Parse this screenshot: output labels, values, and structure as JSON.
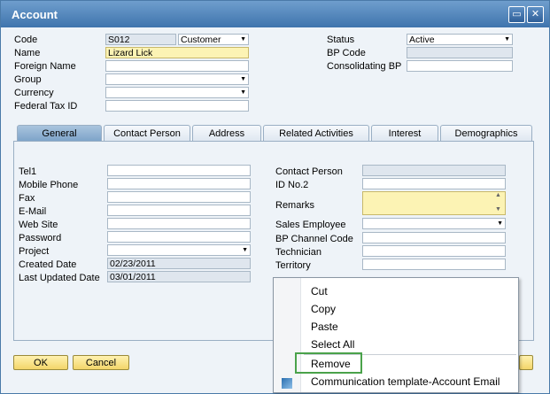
{
  "window": {
    "title": "Account"
  },
  "header": {
    "code": {
      "label": "Code",
      "value": "S012",
      "type": "Customer"
    },
    "name": {
      "label": "Name",
      "value": "Lizard Lick"
    },
    "foreign_name": {
      "label": "Foreign Name",
      "value": ""
    },
    "group": {
      "label": "Group",
      "value": ""
    },
    "currency": {
      "label": "Currency",
      "value": ""
    },
    "federal_tax_id": {
      "label": "Federal Tax ID",
      "value": ""
    },
    "status": {
      "label": "Status",
      "value": "Active"
    },
    "bp_code": {
      "label": "BP Code",
      "value": ""
    },
    "consolidating_bp": {
      "label": "Consolidating BP",
      "value": ""
    }
  },
  "tabs": [
    {
      "label": "General"
    },
    {
      "label": "Contact Person"
    },
    {
      "label": "Address"
    },
    {
      "label": "Related Activities"
    },
    {
      "label": "Interest"
    },
    {
      "label": "Demographics"
    }
  ],
  "general": {
    "tel1": {
      "label": "Tel1",
      "value": ""
    },
    "mobile_phone": {
      "label": "Mobile Phone",
      "value": ""
    },
    "fax": {
      "label": "Fax",
      "value": ""
    },
    "email": {
      "label": "E-Mail",
      "value": ""
    },
    "web_site": {
      "label": "Web Site",
      "value": ""
    },
    "password": {
      "label": "Password",
      "value": ""
    },
    "project": {
      "label": "Project",
      "value": ""
    },
    "created_date": {
      "label": "Created Date",
      "value": "02/23/2011"
    },
    "last_updated_date": {
      "label": "Last Updated Date",
      "value": "03/01/2011"
    },
    "contact_person": {
      "label": "Contact Person",
      "value": ""
    },
    "id_no2": {
      "label": "ID No.2",
      "value": ""
    },
    "remarks": {
      "label": "Remarks",
      "value": ""
    },
    "sales_employee": {
      "label": "Sales Employee",
      "value": ""
    },
    "bp_channel_code": {
      "label": "BP Channel Code",
      "value": ""
    },
    "technician": {
      "label": "Technician",
      "value": ""
    },
    "territory": {
      "label": "Territory",
      "value": ""
    }
  },
  "buttons": {
    "ok": "OK",
    "cancel": "Cancel"
  },
  "context_menu": {
    "items": [
      "Cut",
      "Copy",
      "Paste",
      "Select All",
      "Remove",
      "Communication template-Account Email"
    ]
  }
}
